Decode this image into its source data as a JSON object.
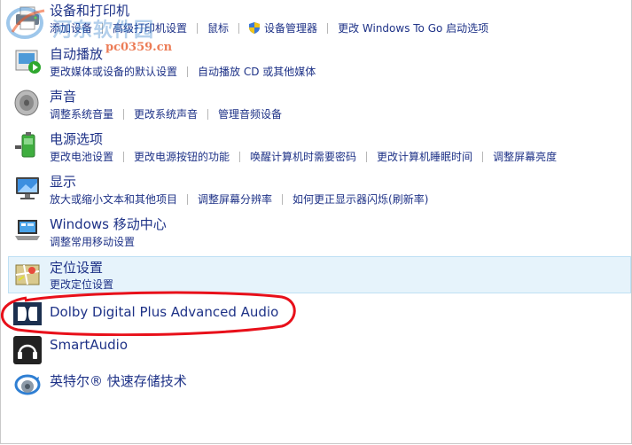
{
  "watermark": {
    "brand": "河东软件园",
    "url": "pc0359.cn"
  },
  "items": [
    {
      "title": "设备和打印机",
      "links": [
        "添加设备",
        "高级打印机设置",
        "鼠标",
        "设备管理器",
        "更改 Windows To Go 启动选项"
      ]
    },
    {
      "title": "自动播放",
      "links": [
        "更改媒体或设备的默认设置",
        "自动播放 CD 或其他媒体"
      ]
    },
    {
      "title": "声音",
      "links": [
        "调整系统音量",
        "更改系统声音",
        "管理音频设备"
      ]
    },
    {
      "title": "电源选项",
      "links": [
        "更改电池设置",
        "更改电源按钮的功能",
        "唤醒计算机时需要密码",
        "更改计算机睡眠时间",
        "调整屏幕亮度"
      ]
    },
    {
      "title": "显示",
      "links": [
        "放大或缩小文本和其他项目",
        "调整屏幕分辨率",
        "如何更正显示器闪烁(刷新率)"
      ]
    },
    {
      "title": "Windows 移动中心",
      "links": [
        "调整常用移动设置"
      ]
    },
    {
      "title": "定位设置",
      "links": [
        "更改定位设置"
      ],
      "highlighted": true
    },
    {
      "title": "Dolby Digital Plus Advanced Audio",
      "annotated": true
    },
    {
      "title": "SmartAudio"
    },
    {
      "title": "英特尔® 快速存储技术"
    }
  ],
  "colors": {
    "link": "#1e3287",
    "highlight_bg": "#e6f3fb",
    "annotation": "#e8101a"
  }
}
